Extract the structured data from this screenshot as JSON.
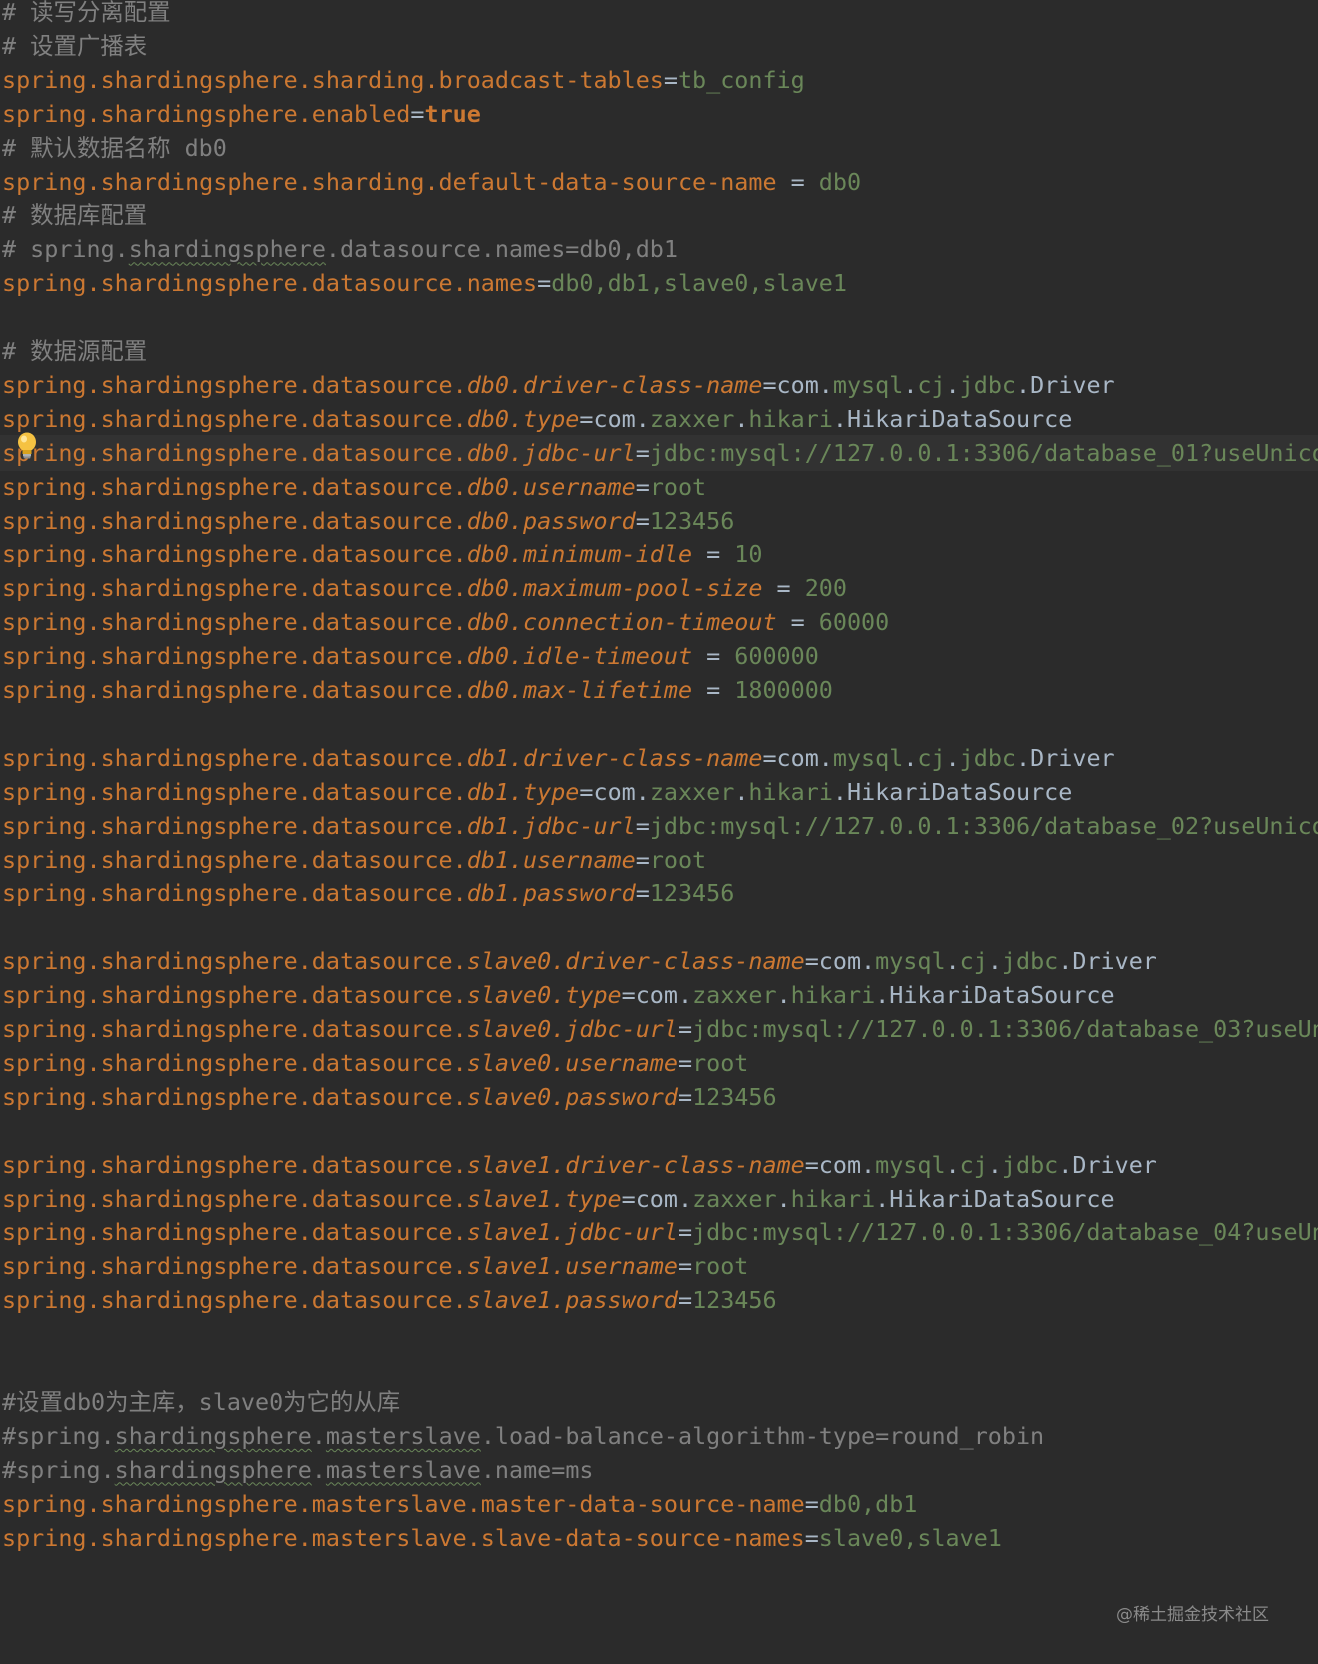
{
  "editor": {
    "lines": [
      {
        "t": "comment",
        "text": "# 读写分离配置"
      },
      {
        "t": "comment",
        "text": "# 设置广播表"
      },
      {
        "t": "kv",
        "key": "spring.shardingsphere.sharding.broadcast-tables",
        "value": "tb_config"
      },
      {
        "t": "kv",
        "key": "spring.shardingsphere.enabled",
        "value": "true",
        "value_style": "bool"
      },
      {
        "t": "comment",
        "text": "# 默认数据名称 db0"
      },
      {
        "t": "kv",
        "key": "spring.shardingsphere.sharding.default-data-source-name",
        "sep": " = ",
        "value": "db0"
      },
      {
        "t": "comment",
        "text": "# 数据库配置"
      },
      {
        "t": "comment_typo",
        "before": "# spring.",
        "typo": "shardingsphere",
        "after": ".datasource.names=db0,db1"
      },
      {
        "t": "kv",
        "key": "spring.shardingsphere.datasource.names",
        "value": "db0,db1,slave0,slave1"
      },
      {
        "t": "blank"
      },
      {
        "t": "comment",
        "text": "# 数据源配置"
      },
      {
        "t": "kvi",
        "prefix": "spring.shardingsphere.datasource.",
        "ikey": "db0.driver-class-name",
        "value": "com.mysql.cj.jdbc.Driver",
        "value_style": "class"
      },
      {
        "t": "kvi",
        "prefix": "spring.shardingsphere.datasource.",
        "ikey": "db0.type",
        "value": "com.zaxxer.hikari.HikariDataSource",
        "value_style": "class"
      },
      {
        "t": "kvi",
        "prefix": "spring.shardingsphere.datasource.",
        "ikey": "db0.jdbc-url",
        "value": "jdbc:mysql://127.0.0.1:3306/database_01?useUnico",
        "caret": true
      },
      {
        "t": "kvi",
        "prefix": "spring.shardingsphere.datasource.",
        "ikey": "db0.username",
        "value": "root"
      },
      {
        "t": "kvi",
        "prefix": "spring.shardingsphere.datasource.",
        "ikey": "db0.password",
        "value": "123456"
      },
      {
        "t": "kvi",
        "prefix": "spring.shardingsphere.datasource.",
        "ikey": "db0.minimum-idle",
        "sep": " = ",
        "value": "10"
      },
      {
        "t": "kvi",
        "prefix": "spring.shardingsphere.datasource.",
        "ikey": "db0.maximum-pool-size",
        "sep": " = ",
        "value": "200"
      },
      {
        "t": "kvi",
        "prefix": "spring.shardingsphere.datasource.",
        "ikey": "db0.connection-timeout",
        "sep": " = ",
        "value": "60000"
      },
      {
        "t": "kvi",
        "prefix": "spring.shardingsphere.datasource.",
        "ikey": "db0.idle-timeout",
        "sep": " = ",
        "value": "600000"
      },
      {
        "t": "kvi",
        "prefix": "spring.shardingsphere.datasource.",
        "ikey": "db0.max-lifetime",
        "sep": " = ",
        "value": "1800000"
      },
      {
        "t": "blank"
      },
      {
        "t": "kvi",
        "prefix": "spring.shardingsphere.datasource.",
        "ikey": "db1.driver-class-name",
        "value": "com.mysql.cj.jdbc.Driver",
        "value_style": "class"
      },
      {
        "t": "kvi",
        "prefix": "spring.shardingsphere.datasource.",
        "ikey": "db1.type",
        "value": "com.zaxxer.hikari.HikariDataSource",
        "value_style": "class"
      },
      {
        "t": "kvi",
        "prefix": "spring.shardingsphere.datasource.",
        "ikey": "db1.jdbc-url",
        "value": "jdbc:mysql://127.0.0.1:3306/database_02?useUnico"
      },
      {
        "t": "kvi",
        "prefix": "spring.shardingsphere.datasource.",
        "ikey": "db1.username",
        "value": "root"
      },
      {
        "t": "kvi",
        "prefix": "spring.shardingsphere.datasource.",
        "ikey": "db1.password",
        "value": "123456"
      },
      {
        "t": "blank"
      },
      {
        "t": "kvi",
        "prefix": "spring.shardingsphere.datasource.",
        "ikey": "slave0.driver-class-name",
        "value": "com.mysql.cj.jdbc.Driver",
        "value_style": "class"
      },
      {
        "t": "kvi",
        "prefix": "spring.shardingsphere.datasource.",
        "ikey": "slave0.type",
        "value": "com.zaxxer.hikari.HikariDataSource",
        "value_style": "class"
      },
      {
        "t": "kvi",
        "prefix": "spring.shardingsphere.datasource.",
        "ikey": "slave0.jdbc-url",
        "value": "jdbc:mysql://127.0.0.1:3306/database_03?useUn"
      },
      {
        "t": "kvi",
        "prefix": "spring.shardingsphere.datasource.",
        "ikey": "slave0.username",
        "value": "root"
      },
      {
        "t": "kvi",
        "prefix": "spring.shardingsphere.datasource.",
        "ikey": "slave0.password",
        "value": "123456"
      },
      {
        "t": "blank"
      },
      {
        "t": "kvi",
        "prefix": "spring.shardingsphere.datasource.",
        "ikey": "slave1.driver-class-name",
        "value": "com.mysql.cj.jdbc.Driver",
        "value_style": "class"
      },
      {
        "t": "kvi",
        "prefix": "spring.shardingsphere.datasource.",
        "ikey": "slave1.type",
        "value": "com.zaxxer.hikari.HikariDataSource",
        "value_style": "class"
      },
      {
        "t": "kvi",
        "prefix": "spring.shardingsphere.datasource.",
        "ikey": "slave1.jdbc-url",
        "value": "jdbc:mysql://127.0.0.1:3306/database_04?useUn"
      },
      {
        "t": "kvi",
        "prefix": "spring.shardingsphere.datasource.",
        "ikey": "slave1.username",
        "value": "root"
      },
      {
        "t": "kvi",
        "prefix": "spring.shardingsphere.datasource.",
        "ikey": "slave1.password",
        "value": "123456"
      },
      {
        "t": "blank"
      },
      {
        "t": "blank"
      },
      {
        "t": "comment",
        "text": "#设置db0为主库，slave0为它的从库"
      },
      {
        "t": "comment_typo2",
        "before": "#spring.",
        "typo1": "shardingsphere",
        "mid": ".",
        "typo2": "masterslave",
        "after": ".load-balance-algorithm-type=round_robin"
      },
      {
        "t": "comment_typo2",
        "before": "#spring.",
        "typo1": "shardingsphere",
        "mid": ".",
        "typo2": "masterslave",
        "after": ".name=ms"
      },
      {
        "t": "kv",
        "key": "spring.shardingsphere.masterslave.master-data-source-name",
        "value": "db0,db1"
      },
      {
        "t": "kv",
        "key": "spring.shardingsphere.masterslave.slave-data-source-names",
        "value": "slave0,slave1"
      }
    ]
  },
  "intention_icon": "lightbulb-icon",
  "watermark": "@稀土掘金技术社区",
  "colors": {
    "background": "#2b2b2b",
    "caret_line": "#323232",
    "key": "#cc7832",
    "value": "#6a8759",
    "comment": "#808080",
    "plain": "#a9b7c6"
  }
}
